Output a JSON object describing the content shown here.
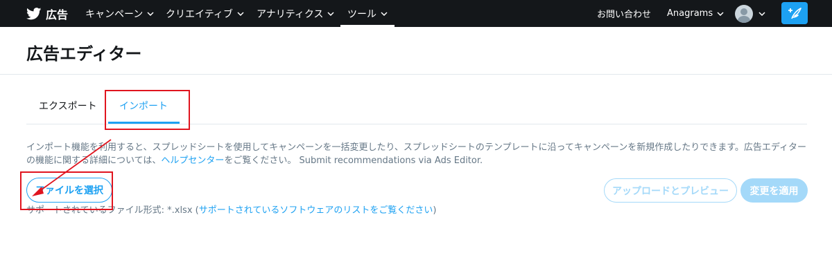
{
  "topbar": {
    "brand_label": "広告",
    "nav": [
      {
        "label": "キャンペーン"
      },
      {
        "label": "クリエイティブ"
      },
      {
        "label": "アナリティクス"
      },
      {
        "label": "ツール"
      }
    ],
    "contact_label": "お問い合わせ",
    "account_label": "Anagrams",
    "compose_icon": "compose-tweet-icon"
  },
  "page": {
    "title": "広告エディター"
  },
  "tabs": [
    {
      "label": "エクスポート"
    },
    {
      "label": "インポート"
    }
  ],
  "description": {
    "text_before_link": "インポート機能を利用すると、スプレッドシートを使用してキャンペーンを一括変更したり、スプレッドシートのテンプレートに沿ってキャンペーンを新規作成したりできます。広告エディターの機能に関する詳細については、",
    "link": "ヘルプセンター",
    "text_after_link": "をご覧ください。 Submit recommendations via Ads Editor."
  },
  "actions": {
    "select_file": "ファイルを選択",
    "supported_prefix": "サポートされているファイル形式: *.xlsx (",
    "supported_link": "サポートされているソフトウェアのリストをご覧ください",
    "supported_suffix": ")",
    "upload_preview": "アップロードとプレビュー",
    "apply_changes": "変更を適用"
  },
  "colors": {
    "accent": "#1da1f2",
    "accent_disabled": "#a4d9f9",
    "nav_bg": "#14171a",
    "annotation": "#e0141e"
  }
}
